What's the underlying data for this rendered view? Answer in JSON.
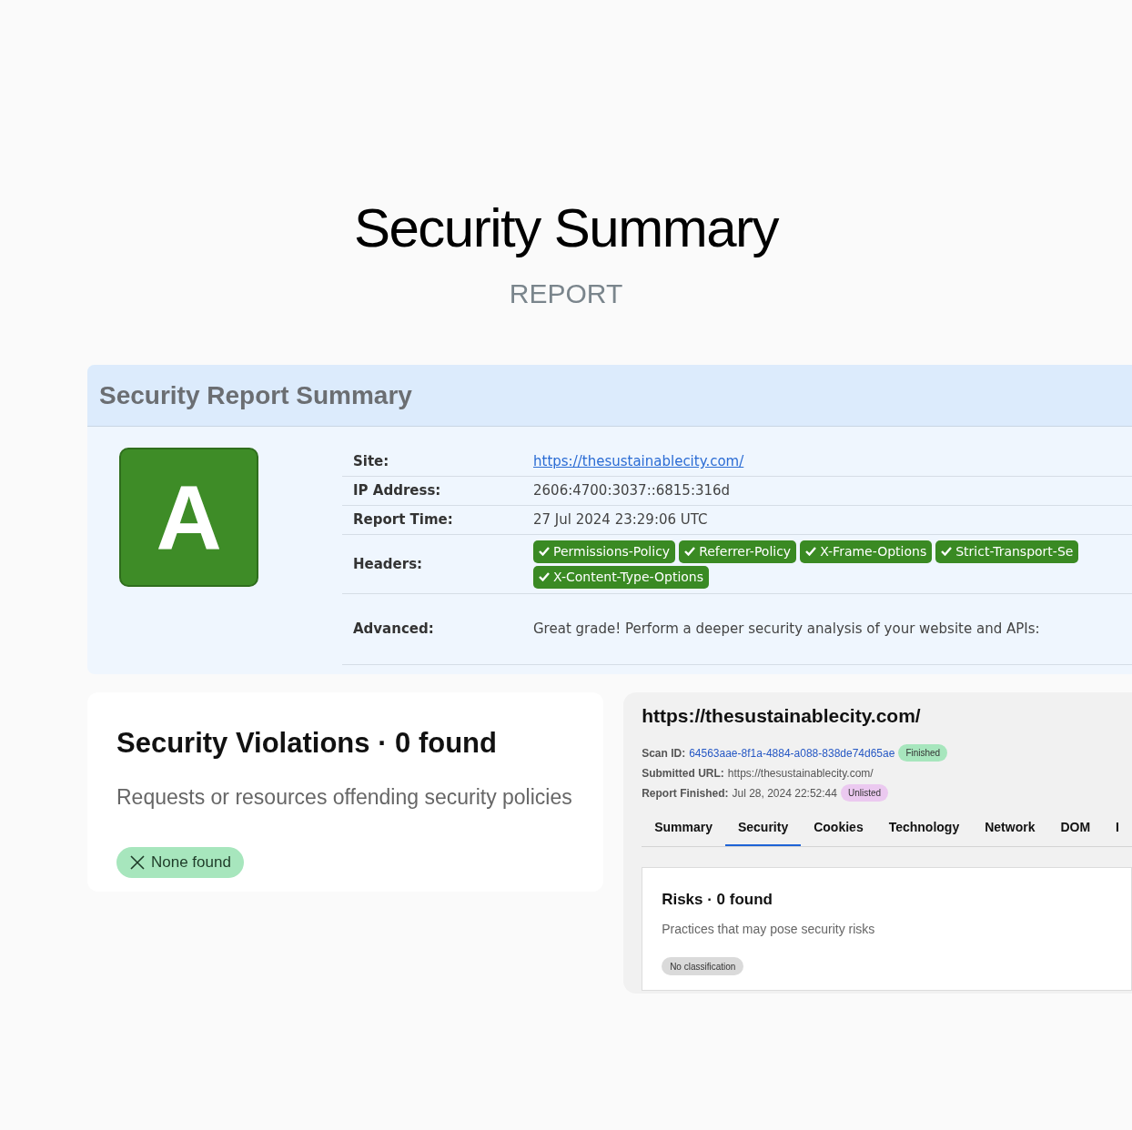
{
  "title": "Security Summary",
  "subtitle": "REPORT",
  "report": {
    "heading": "Security Report Summary",
    "grade": "A",
    "rows": [
      {
        "kind": "link",
        "label": "Site:",
        "value": "https://thesustainablecity.com/"
      },
      {
        "kind": "text",
        "label": "IP Address:",
        "value": "2606:4700:3037::6815:316d"
      },
      {
        "kind": "text",
        "label": "Report Time:",
        "value": "27 Jul 2024 23:29:06 UTC"
      },
      {
        "kind": "headers",
        "label": "Headers:",
        "headers": [
          "Permissions-Policy",
          "Referrer-Policy",
          "X-Frame-Options",
          "Strict-Transport-Se",
          "X-Content-Type-Options"
        ]
      },
      {
        "kind": "advanced",
        "label": "Advanced:",
        "value": "Great grade! Perform a deeper security analysis of your website and APIs:"
      }
    ]
  },
  "violations": {
    "title": "Security Violations · 0 found",
    "description": "Requests or resources offending security policies",
    "badge": "None found"
  },
  "scan": {
    "url": "https://thesustainablecity.com/",
    "meta": [
      {
        "label": "Scan ID:",
        "value": "64563aae-8f1a-4884-a088-838de74d65ae",
        "kind": "link",
        "badge": "Finished",
        "color": "#a7e6bd"
      },
      {
        "label": "Submitted URL:",
        "value": "https://thesustainablecity.com/",
        "kind": "text"
      },
      {
        "label": "Report Finished:",
        "value": "Jul 28, 2024 22:52:44",
        "kind": "text",
        "badge": "Unlisted",
        "color": "#ebc9f0"
      }
    ],
    "tabs": [
      {
        "label": "Summary",
        "selected": false
      },
      {
        "label": "Security",
        "selected": true
      },
      {
        "label": "Cookies",
        "selected": false
      },
      {
        "label": "Technology",
        "selected": false
      },
      {
        "label": "Network",
        "selected": false
      },
      {
        "label": "DOM",
        "selected": false
      },
      {
        "label": "I",
        "selected": false
      }
    ],
    "risks": {
      "title": "Risks · 0 found",
      "description": "Practices that may pose security risks",
      "badge": "No classification"
    }
  }
}
